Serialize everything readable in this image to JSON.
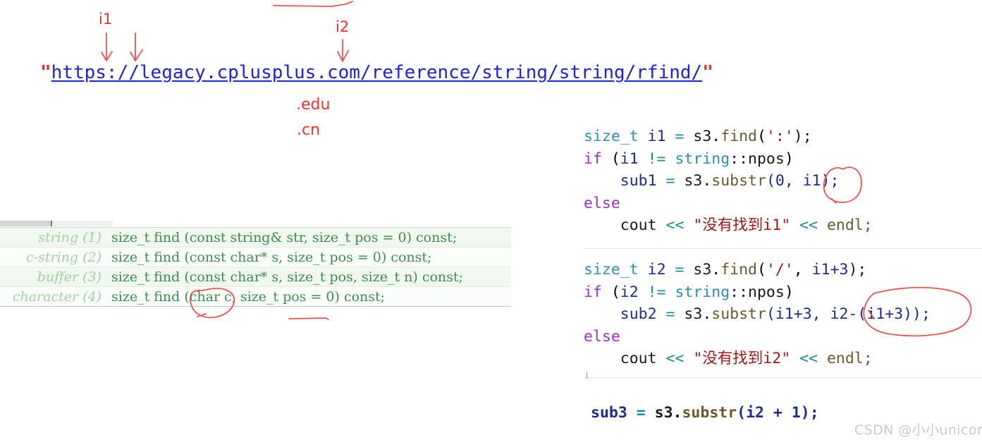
{
  "url_annotation": {
    "open_quote": "\"",
    "url": "https://legacy.cplusplus.com/reference/string/string/rfind/",
    "close_quote": "\"",
    "labels": {
      "i1": "i1",
      "i2": "i2",
      "edu": ".edu",
      "cn": ".cn"
    },
    "ink_color": "#f03030",
    "link_color": "#2020e0"
  },
  "find_table": {
    "text_color": "#3b8f4e",
    "label_color": "#9fd39f",
    "rows": [
      {
        "label": "string (1)",
        "signature": "size_t find (const string& str, size_t pos = 0) const;"
      },
      {
        "label": "c-string (2)",
        "signature": "size_t find (const char* s, size_t pos = 0) const;"
      },
      {
        "label": "buffer (3)",
        "signature": "size_t find (const char* s, size_t pos, size_t n) const;"
      },
      {
        "label": "character (4)",
        "signature": "size_t find (char c, size_t pos = 0) const;"
      }
    ]
  },
  "code": {
    "block1": {
      "line1": {
        "type": "size_t",
        "var": "i1",
        "eq": "=",
        "obj": "s3",
        "fn": "find",
        "arg": "':'",
        "tail": ");"
      },
      "line2": {
        "kw": "if",
        "cond_var": "i1",
        "op": "!=",
        "type": "string",
        "npos": "::npos"
      },
      "line3": {
        "var": "sub1",
        "eq": "=",
        "obj": "s3",
        "fn": "substr",
        "args": "(0, i1);"
      },
      "line4": {
        "kw": "else"
      },
      "line5": {
        "obj": "cout",
        "op": "<<",
        "str": "\"没有找到i1\"",
        "op2": "<<",
        "endl": "endl;"
      }
    },
    "block2": {
      "line1": {
        "type": "size_t",
        "var": "i2",
        "eq": "=",
        "obj": "s3",
        "fn": "find",
        "arg": "'/'",
        "arg2": "i1+3",
        "tail": ");"
      },
      "line2": {
        "kw": "if",
        "cond_var": "i2",
        "op": "!=",
        "type": "string",
        "npos": "::npos"
      },
      "line3": {
        "var": "sub2",
        "eq": "=",
        "obj": "s3",
        "fn": "substr",
        "args": "(i1+3, i2-(i1+3));"
      },
      "line4": {
        "kw": "else"
      },
      "line5": {
        "obj": "cout",
        "op": "<<",
        "str": "\"没有找到i2\"",
        "op2": "<<",
        "endl": "endl;"
      }
    },
    "block3": {
      "line1": {
        "var": "sub3",
        "eq": "=",
        "obj": "s3",
        "fn": "substr",
        "args": "(i2 + 1);"
      }
    },
    "colors": {
      "keyword": "#9b30c8",
      "type": "#2b91af",
      "identifier": "#1f2b8f",
      "operator": "#1a8f8f",
      "string": "#a31515",
      "function": "#6a5a2a"
    }
  },
  "watermark": {
    "text": "CSDN @小小unicorn"
  }
}
